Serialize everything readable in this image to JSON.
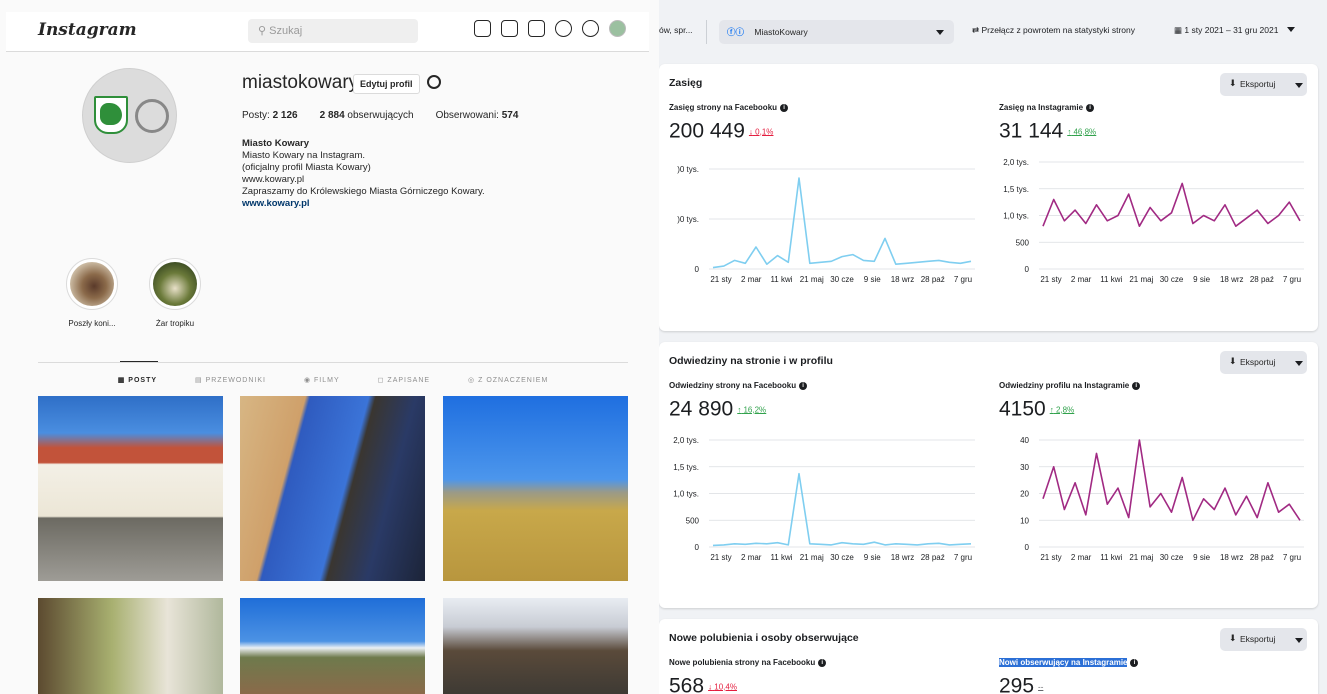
{
  "instagram": {
    "logo": "Instagram",
    "search_placeholder": "Szukaj",
    "username": "miastokowary",
    "edit_profile": "Edytuj profil",
    "posts_label": "Posty:",
    "posts_count": "2 126",
    "followers_count": "2 884",
    "followers_label": "obserwujących",
    "following_label": "Obserwowani:",
    "following_count": "574",
    "bio": {
      "name": "Miasto Kowary",
      "line1": "Miasto Kowary na Instagram.",
      "line2": "(oficjalny profil Miasta Kowary)",
      "line3": "www.kowary.pl",
      "line4": "Zapraszamy do Królewskiego Miasta Górniczego Kowary.",
      "link": "www.kowary.pl"
    },
    "highlights": [
      {
        "label": "Poszły koni..."
      },
      {
        "label": "Żar tropiku"
      }
    ],
    "tabs": [
      "POSTY",
      "PRZEWODNIKI",
      "FILMY",
      "ZAPISANE",
      "Z OZNACZENIEM"
    ]
  },
  "facebook": {
    "cut_text": "ów, spr...",
    "account": "MiastoKowary",
    "switch_label": "Przełącz z powrotem na statystyki strony",
    "date_range": "1 sty 2021 – 31 gru 2021",
    "export_label": "Eksportuj"
  },
  "cards": [
    {
      "title": "Zasięg",
      "left": {
        "label": "Zasięg strony na Facebooku",
        "value": "200 449",
        "change": "0,1%",
        "arrow": "↓"
      },
      "right": {
        "label": "Zasięg na Instagramie",
        "value": "31 144",
        "change": "46,8%",
        "arrow": "↑"
      }
    },
    {
      "title": "Odwiedziny na stronie i w profilu",
      "left": {
        "label": "Odwiedziny strony na Facebooku",
        "value": "24 890",
        "change": "16,2%",
        "arrow": "↑"
      },
      "right": {
        "label": "Odwiedziny profilu na Instagramie",
        "value": "4150",
        "change": "2,8%",
        "arrow": "↑"
      }
    },
    {
      "title": "Nowe polubienia i osoby obserwujące",
      "left": {
        "label": "Nowe polubienia strony na Facebooku",
        "value": "568",
        "change": "10,4%",
        "arrow": "↓"
      },
      "right": {
        "label": "Nowi obserwujący na Instagramie",
        "value": "295",
        "change": "--",
        "arrow": ""
      }
    }
  ],
  "chart_data": [
    {
      "type": "line",
      "title": "Zasięg strony na Facebooku",
      "x_ticks": [
        "21 sty",
        "2 mar",
        "11 kwi",
        "21 maj",
        "30 cze",
        "9 sie",
        "18 wrz",
        "28 paź",
        "7 gru"
      ],
      "y_ticks": [
        "0",
        ")0 tys.",
        ")0 tys."
      ],
      "series": [
        {
          "color": "#7fcef0",
          "values": [
            150,
            300,
            900,
            600,
            2300,
            500,
            1400,
            700,
            9500,
            600,
            700,
            800,
            1300,
            1500,
            900,
            800,
            3200,
            500,
            600,
            700,
            800,
            900,
            700,
            600,
            800
          ]
        }
      ]
    },
    {
      "type": "line",
      "title": "Zasięg na Instagramie",
      "x_ticks": [
        "21 sty",
        "2 mar",
        "11 kwi",
        "21 maj",
        "30 cze",
        "9 sie",
        "18 wrz",
        "28 paź",
        "7 gru"
      ],
      "y_ticks": [
        "0",
        "500",
        "1,0 tys.",
        "1,5 tys.",
        "2,0 tys."
      ],
      "ylim": [
        0,
        2000
      ],
      "series": [
        {
          "color": "#a12a83",
          "values": [
            800,
            1300,
            900,
            1100,
            850,
            1200,
            900,
            1000,
            1400,
            800,
            1150,
            900,
            1050,
            1600,
            850,
            1000,
            900,
            1200,
            800,
            950,
            1100,
            850,
            1000,
            1250,
            900
          ]
        }
      ]
    },
    {
      "type": "line",
      "title": "Odwiedziny strony na Facebooku",
      "x_ticks": [
        "21 sty",
        "2 mar",
        "11 kwi",
        "21 maj",
        "30 cze",
        "9 sie",
        "18 wrz",
        "28 paź",
        "7 gru"
      ],
      "y_ticks": [
        "0",
        "500",
        "1,0 tys.",
        "1,5 tys.",
        "2,0 tys."
      ],
      "ylim": [
        0,
        2000
      ],
      "series": [
        {
          "color": "#7fcef0",
          "values": [
            30,
            40,
            60,
            50,
            70,
            60,
            80,
            40,
            1370,
            60,
            50,
            40,
            80,
            60,
            50,
            90,
            40,
            60,
            50,
            40,
            60,
            70,
            40,
            50,
            60
          ]
        }
      ]
    },
    {
      "type": "line",
      "title": "Odwiedziny profilu na Instagramie",
      "x_ticks": [
        "21 sty",
        "2 mar",
        "11 kwi",
        "21 maj",
        "30 cze",
        "9 sie",
        "18 wrz",
        "28 paź",
        "7 gru"
      ],
      "y_ticks": [
        "0",
        "10",
        "20",
        "30",
        "40"
      ],
      "ylim": [
        0,
        40
      ],
      "series": [
        {
          "color": "#a12a83",
          "values": [
            18,
            30,
            14,
            24,
            12,
            35,
            16,
            22,
            11,
            40,
            15,
            20,
            13,
            26,
            10,
            18,
            14,
            22,
            12,
            19,
            11,
            24,
            13,
            16,
            10
          ]
        }
      ]
    }
  ]
}
